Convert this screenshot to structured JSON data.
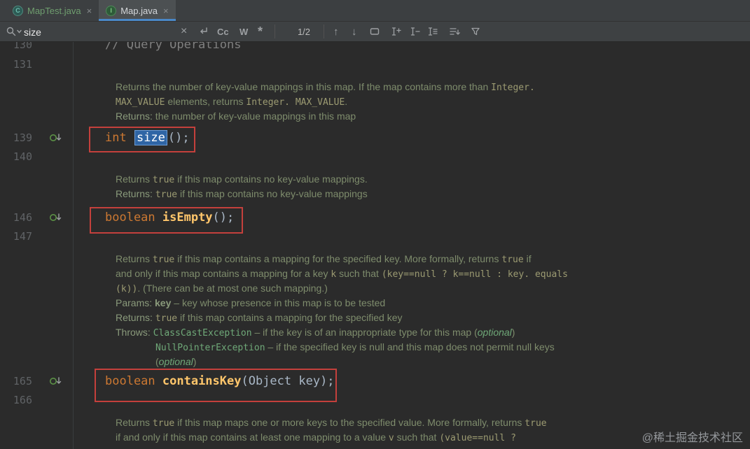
{
  "tabs": {
    "items": [
      {
        "label": "MapTest.java",
        "icon_letter": "C"
      },
      {
        "label": "Map.java",
        "icon_letter": "I"
      }
    ]
  },
  "icons": {
    "close": "×",
    "clear": "×",
    "prev": "↑",
    "next": "↓"
  },
  "find_bar": {
    "query": "size",
    "match_counter": "1/2",
    "toggles": {
      "match_case": "Cc",
      "words": "W",
      "regex": "*"
    }
  },
  "editor": {
    "gutter": {
      "n130": "130",
      "n131": "131",
      "n139": "139",
      "n140": "140",
      "n146": "146",
      "n147": "147",
      "n165": "165",
      "n166": "166"
    },
    "comment": "// Query Operations",
    "doc1": {
      "l1": [
        "Returns the number of key-value mappings in this map. If the map contains more than ",
        "Integer."
      ],
      "l2": [
        "MAX_VALUE",
        " elements, returns ",
        "Integer. MAX_VALUE",
        "."
      ],
      "l3": [
        "Returns:",
        " the number of key-value mappings in this map"
      ]
    },
    "code139": {
      "keyword": "int ",
      "name": "size",
      "rest": "();"
    },
    "doc2": {
      "l1": [
        "Returns ",
        "true",
        " if this map contains no key-value mappings."
      ],
      "l2": [
        "Returns: ",
        "true",
        " if this map contains no key-value mappings"
      ]
    },
    "code146": {
      "keyword": "boolean ",
      "name": "isEmpty",
      "rest": "();"
    },
    "doc3": {
      "l1": [
        "Returns ",
        "true",
        " if this map contains a mapping for the specified key. More formally, returns ",
        "true",
        " if"
      ],
      "l2": [
        "and only if this map contains a mapping for a key ",
        "k",
        " such that ",
        "(key==null ? k==null : key. equals"
      ],
      "l3": [
        "(k))",
        ". (There can be at most one such mapping.)"
      ],
      "l4": [
        "Params: ",
        "key",
        " – key whose presence in this map is to be tested"
      ],
      "l5": [
        "Returns: ",
        "true",
        " if this map contains a mapping for the specified key"
      ],
      "l6": [
        "Throws: ",
        "ClassCastException",
        " – if the key is of an inappropriate type for this map (",
        "optional",
        ")"
      ],
      "l7": [
        "NullPointerException",
        " – if the specified key is null and this map does not permit null keys"
      ],
      "l8": [
        "(",
        "optional",
        ")"
      ]
    },
    "code165": {
      "keyword": "boolean ",
      "name": "containsKey",
      "rest": "(Object key);"
    },
    "doc4": {
      "l1": [
        "Returns ",
        "true",
        " if this map maps one or more keys to the specified value. More formally, returns ",
        "true"
      ],
      "l2": [
        "if and only if this map contains at least one mapping to a value ",
        "v",
        " such that ",
        "(value==null ?"
      ]
    }
  },
  "watermark": "@稀土掘金技术社区"
}
